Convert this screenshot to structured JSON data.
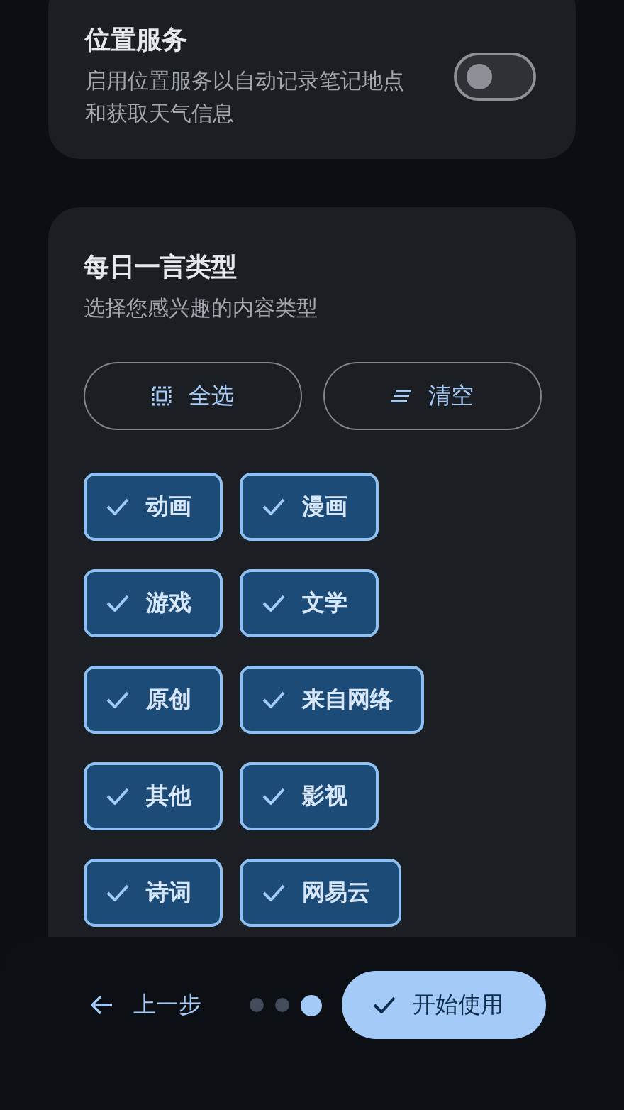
{
  "location": {
    "title": "位置服务",
    "description": "启用位置服务以自动记录笔记地点和获取天气信息",
    "on": false
  },
  "quote_types": {
    "title": "每日一言类型",
    "subtitle": "选择您感兴趣的内容类型",
    "actions": [
      {
        "kind": "select_all",
        "label": "全选"
      },
      {
        "kind": "clear",
        "label": "清空"
      }
    ],
    "chips": [
      {
        "label": "动画",
        "selected": true
      },
      {
        "label": "漫画",
        "selected": true
      },
      {
        "label": "游戏",
        "selected": true
      },
      {
        "label": "文学",
        "selected": true
      },
      {
        "label": "原创",
        "selected": true
      },
      {
        "label": "来自网络",
        "selected": true
      },
      {
        "label": "其他",
        "selected": true
      },
      {
        "label": "影视",
        "selected": true
      },
      {
        "label": "诗词",
        "selected": true
      },
      {
        "label": "网易云",
        "selected": true
      }
    ]
  },
  "footer": {
    "back": "上一步",
    "steps": [
      {
        "selected": false
      },
      {
        "selected": false
      },
      {
        "selected": true
      }
    ],
    "start": "开始使用"
  }
}
